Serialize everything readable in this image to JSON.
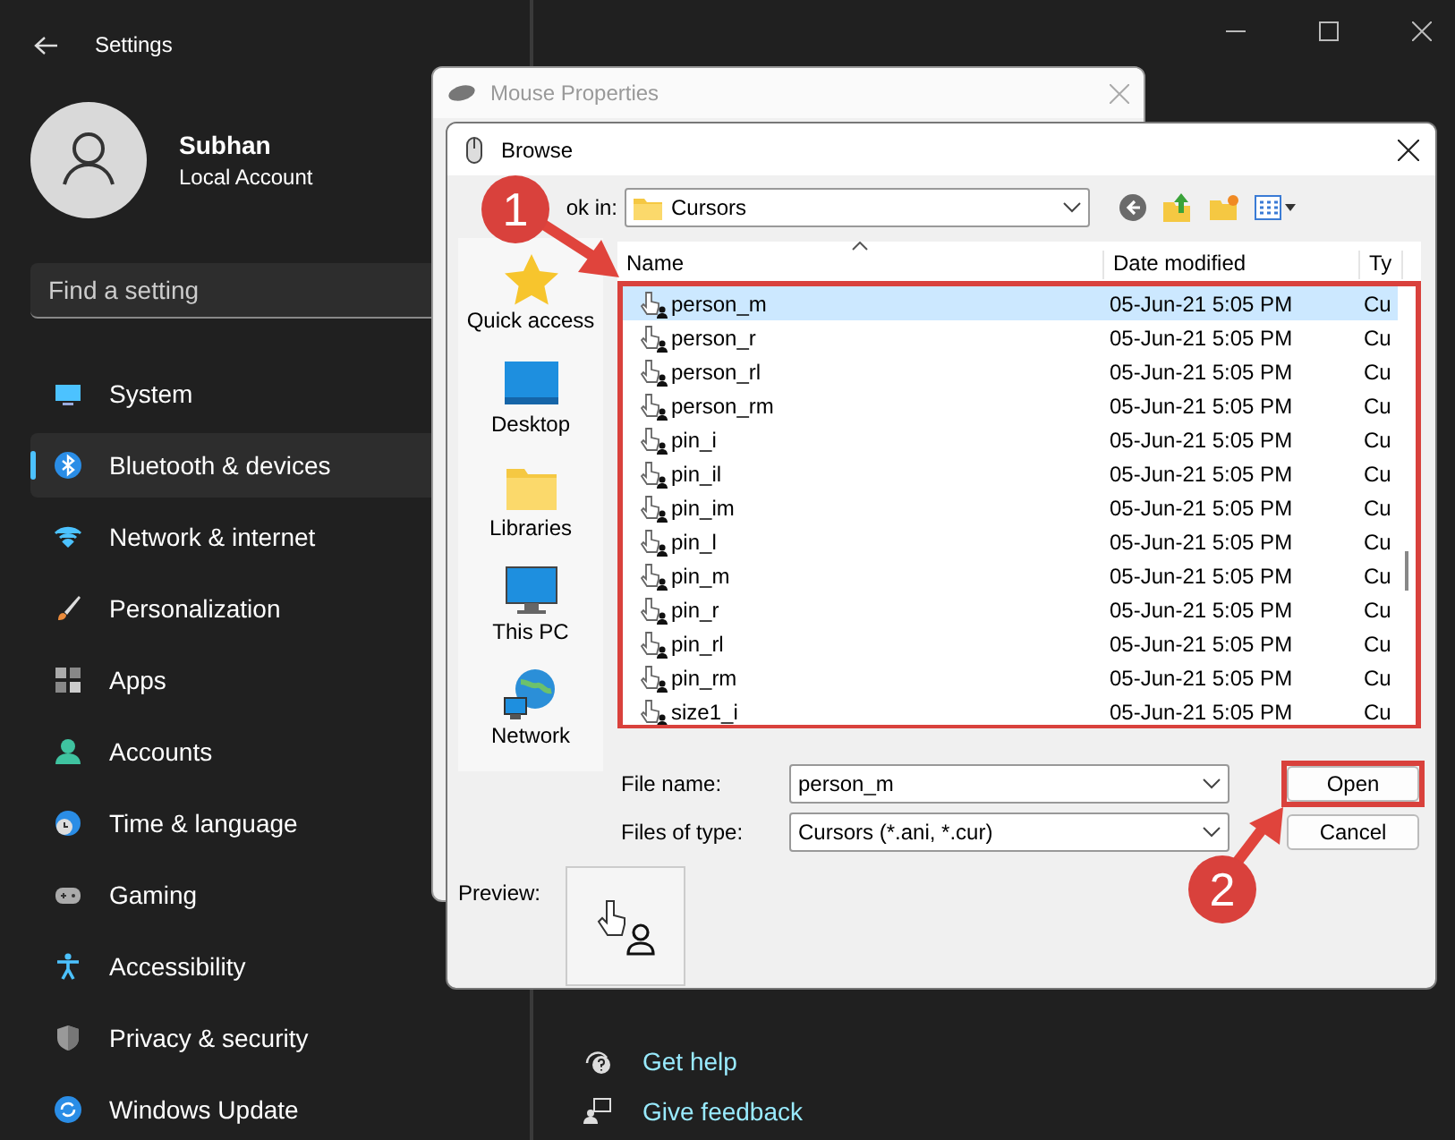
{
  "settings": {
    "title": "Settings",
    "user": {
      "name": "Subhan",
      "account": "Local Account"
    },
    "search": {
      "placeholder": "Find a setting"
    },
    "nav": [
      {
        "label": "System",
        "selected": false
      },
      {
        "label": "Bluetooth & devices",
        "selected": true
      },
      {
        "label": "Network & internet",
        "selected": false
      },
      {
        "label": "Personalization",
        "selected": false
      },
      {
        "label": "Apps",
        "selected": false
      },
      {
        "label": "Accounts",
        "selected": false
      },
      {
        "label": "Time & language",
        "selected": false
      },
      {
        "label": "Gaming",
        "selected": false
      },
      {
        "label": "Accessibility",
        "selected": false
      },
      {
        "label": "Privacy & security",
        "selected": false
      },
      {
        "label": "Windows Update",
        "selected": false
      }
    ],
    "help_links": [
      "Get help",
      "Give feedback"
    ]
  },
  "mouse_properties": {
    "title": "Mouse Properties"
  },
  "browse": {
    "title": "Browse",
    "look_in": {
      "label": "ok in:",
      "value": "Cursors"
    },
    "places": [
      "Quick access",
      "Desktop",
      "Libraries",
      "This PC",
      "Network"
    ],
    "columns": [
      "Name",
      "Date modified",
      "Ty"
    ],
    "rows": [
      {
        "name": "person_m",
        "date": "05-Jun-21 5:05 PM",
        "column_3": "Cu",
        "selected": true
      },
      {
        "name": "person_r",
        "date": "05-Jun-21 5:05 PM",
        "column_3": "Cu",
        "selected": false
      },
      {
        "name": "person_rl",
        "date": "05-Jun-21 5:05 PM",
        "column_3": "Cu",
        "selected": false
      },
      {
        "name": "person_rm",
        "date": "05-Jun-21 5:05 PM",
        "column_3": "Cu",
        "selected": false
      },
      {
        "name": "pin_i",
        "date": "05-Jun-21 5:05 PM",
        "column_3": "Cu",
        "selected": false
      },
      {
        "name": "pin_il",
        "date": "05-Jun-21 5:05 PM",
        "column_3": "Cu",
        "selected": false
      },
      {
        "name": "pin_im",
        "date": "05-Jun-21 5:05 PM",
        "column_3": "Cu",
        "selected": false
      },
      {
        "name": "pin_l",
        "date": "05-Jun-21 5:05 PM",
        "column_3": "Cu",
        "selected": false
      },
      {
        "name": "pin_m",
        "date": "05-Jun-21 5:05 PM",
        "column_3": "Cu",
        "selected": false
      },
      {
        "name": "pin_r",
        "date": "05-Jun-21 5:05 PM",
        "column_3": "Cu",
        "selected": false
      },
      {
        "name": "pin_rl",
        "date": "05-Jun-21 5:05 PM",
        "column_3": "Cu",
        "selected": false
      },
      {
        "name": "pin_rm",
        "date": "05-Jun-21 5:05 PM",
        "column_3": "Cu",
        "selected": false
      },
      {
        "name": "size1_i",
        "date": "05-Jun-21 5:05 PM",
        "column_3": "Cu",
        "selected": false
      }
    ],
    "file_name": {
      "label": "File name:",
      "value": "person_m"
    },
    "file_type": {
      "label": "Files of type:",
      "value": "Cursors (*.ani, *.cur)"
    },
    "buttons": [
      "Open",
      "Cancel"
    ],
    "preview_label": "Preview:"
  },
  "annotations": [
    {
      "label": "1"
    },
    {
      "label": "2"
    }
  ]
}
